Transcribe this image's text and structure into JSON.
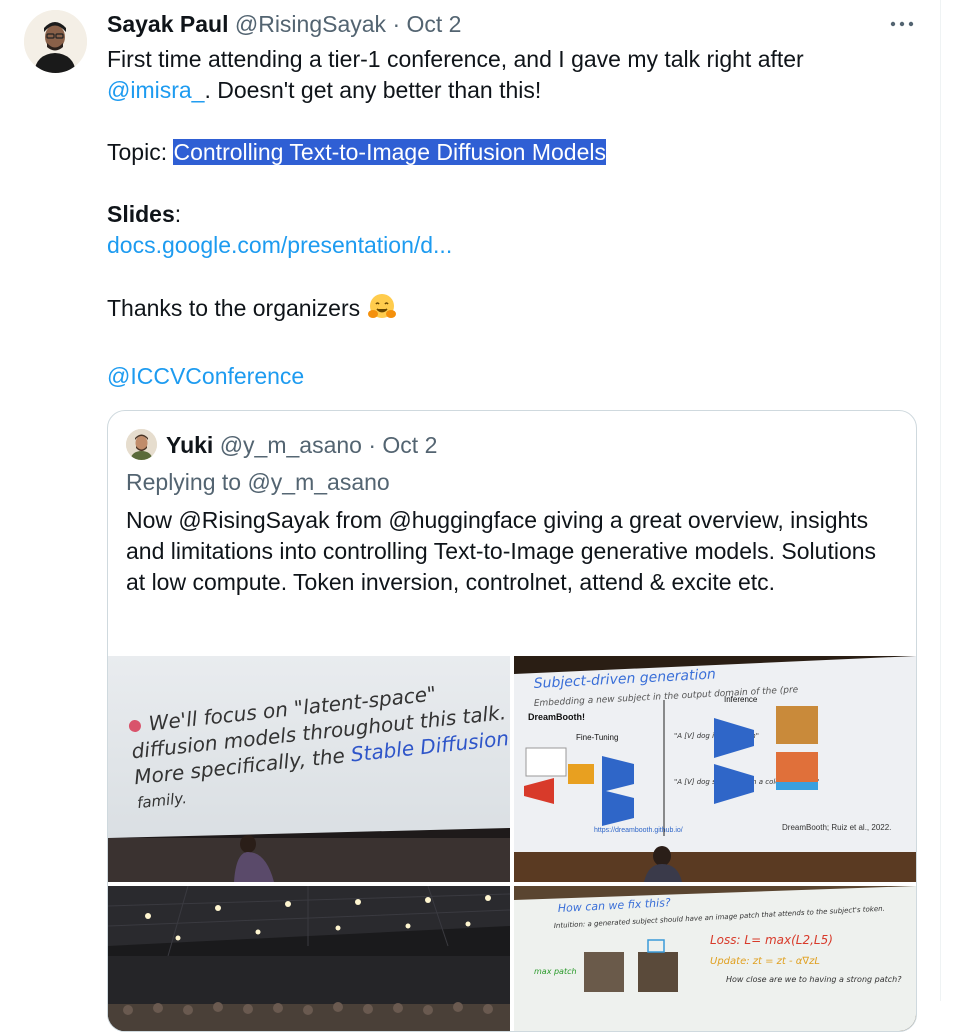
{
  "tweet": {
    "author_name": "Sayak Paul",
    "author_handle": "@RisingSayak",
    "separator": "·",
    "date": "Oct 2",
    "line1": "First time attending a tier-1 conference, and I gave my talk right after",
    "mention_isra": "@imisra_",
    "line2_rest": ". Doesn't get any better than this!",
    "topic_prefix": "Topic: ",
    "topic_title": "Controlling Text-to-Image Diffusion Models",
    "slides_label": "Slides",
    "slides_colon": ":",
    "slides_link": "docs.google.com/presentation/d...",
    "thanks": "Thanks to the organizers",
    "thanks_emoji": "🤗",
    "conference_mention": "@ICCVConference"
  },
  "quoted": {
    "author_name": "Yuki",
    "author_handle": "@y_m_asano",
    "separator": "·",
    "date": "Oct 2",
    "replying_to": "Replying to @y_m_asano",
    "text": "Now @RisingSayak from @huggingface giving a great overview, insights and limitations into controlling Text-to-Image generative models. Solutions at low compute. Token inversion, controlnet, attend & excite etc."
  },
  "media": {
    "slide1": {
      "line1": "We'll focus on \"latent-space\"",
      "line2": "diffusion models throughout this talk.",
      "line3_prefix": "More specifically, the ",
      "line3_highlight": "Stable Diffusion",
      "line4": "family."
    },
    "slide2": {
      "title": "Subject-driven generation",
      "subtitle": "Embedding a new subject in the output domain of the (pre",
      "brand": "DreamBooth!",
      "finetune_label": "Fine-Tuning",
      "inference_label": "Inference",
      "prompt1": "\"A [V] dog in the beach\"",
      "prompt2": "\"A [V] dog swimming in a colorful carpet\"",
      "url": "https://dreambooth.github.io/",
      "citation": "DreamBooth; Ruiz et al., 2022."
    },
    "slide4": {
      "title": "How can we fix this?",
      "intuition": "Intuition: a generated subject should have an image patch that attends to the subject's token.",
      "loss": "Loss: L= max(L2,L5)",
      "update": "Update: zt = zt - α∇zL",
      "question": "How close are we to having a strong patch?",
      "label_max": "max patch"
    }
  },
  "colors": {
    "link": "#1d9bf0",
    "highlight": "#2f5fd4",
    "muted": "#536471",
    "text": "#0f1419",
    "border": "#cfd9de"
  }
}
